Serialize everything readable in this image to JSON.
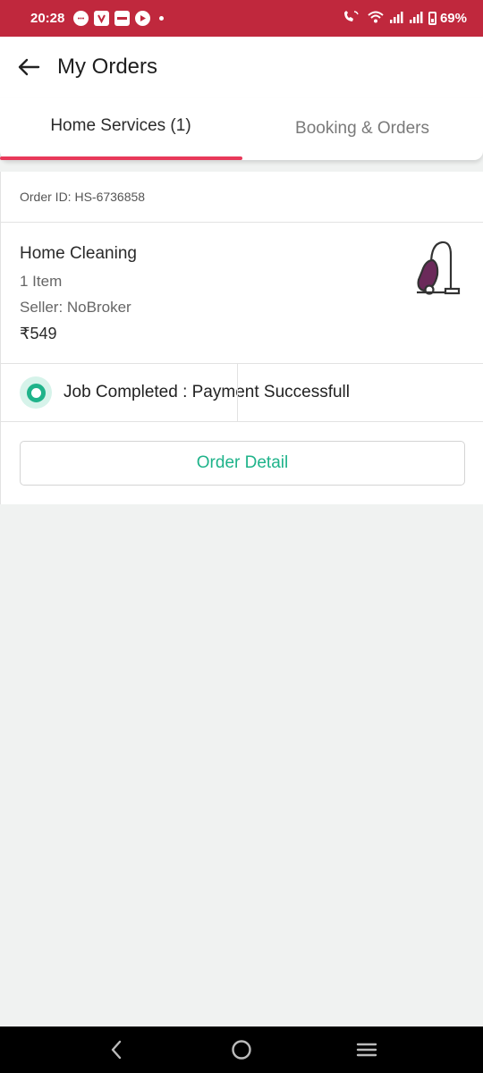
{
  "status_bar": {
    "time": "20:28",
    "battery": "69%"
  },
  "header": {
    "title": "My Orders"
  },
  "tabs": [
    {
      "label": "Home Services (1)",
      "active": true
    },
    {
      "label": "Booking & Orders",
      "active": false
    }
  ],
  "order": {
    "order_id": "Order ID: HS-6736858",
    "item_name": "Home Cleaning",
    "item_count": "1 Item",
    "seller": "Seller: NoBroker",
    "price": "₹549",
    "icon": "vacuum-cleaner-icon",
    "status_text": "Job Completed : Payment Successfull",
    "detail_button": "Order Detail"
  },
  "colors": {
    "status_bar": "#c0283d",
    "tab_indicator": "#e8395a",
    "accent_green": "#1fb38a",
    "vacuum_purple": "#6b2a5a"
  }
}
